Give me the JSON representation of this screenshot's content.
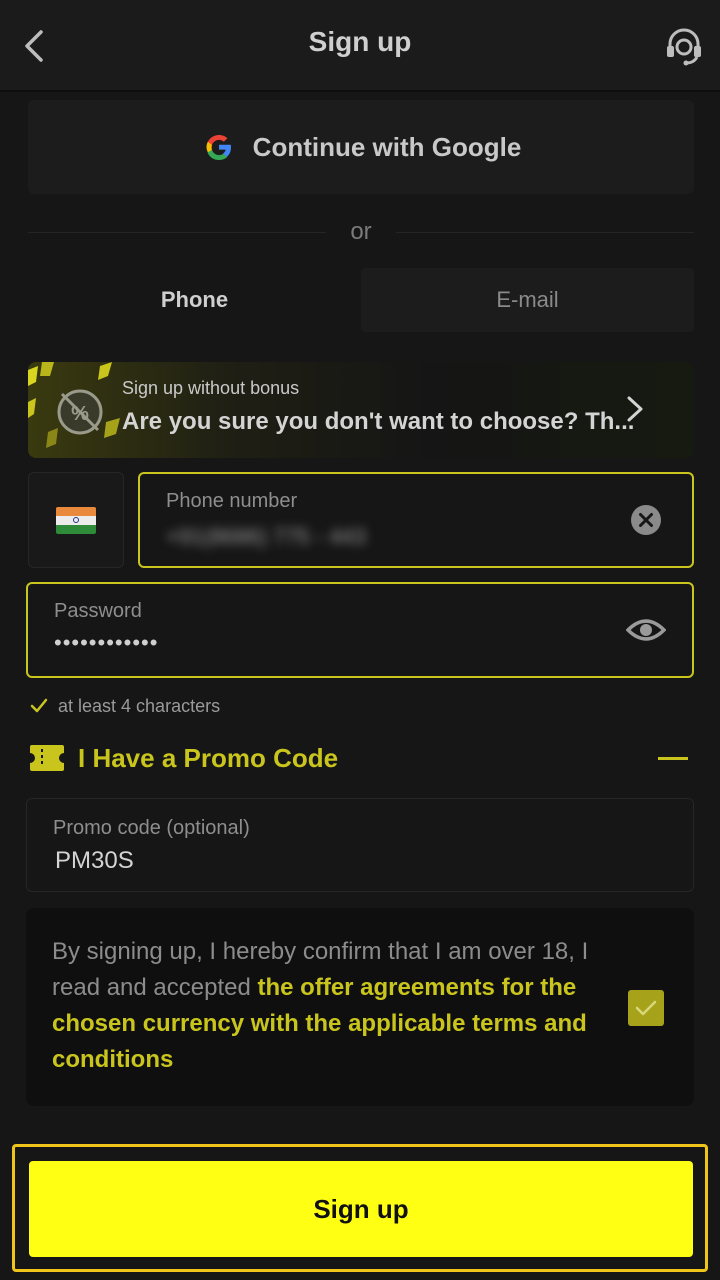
{
  "header": {
    "title": "Sign up",
    "back_icon": "chevron-left-icon",
    "support_icon": "headset-icon"
  },
  "auth": {
    "google_label": "Continue with Google",
    "or_text": "or"
  },
  "tabs": [
    {
      "label": "Phone",
      "active": true
    },
    {
      "label": "E-mail",
      "active": false
    }
  ],
  "bonus_banner": {
    "small_text": "Sign up without bonus",
    "big_text": "Are you sure you don't want to choose? Th..."
  },
  "phone": {
    "label": "Phone number",
    "value": "+91(8686) 775 - 443",
    "country": "India"
  },
  "password": {
    "label": "Password",
    "value": "••••••••••••"
  },
  "password_hint": "at least 4 characters",
  "promo": {
    "toggle_label": "I Have a Promo Code",
    "field_label": "Promo code (optional)",
    "value": "PM30S"
  },
  "terms": {
    "prefix": "By signing up, I hereby confirm that I am over 18, I read and accepted ",
    "link": "the offer agreements for the chosen currency with the applicable terms and conditions",
    "checked": true
  },
  "submit_label": "Sign up",
  "colors": {
    "accent": "#c9c51d",
    "button": "#ffff14",
    "background": "#161616"
  }
}
